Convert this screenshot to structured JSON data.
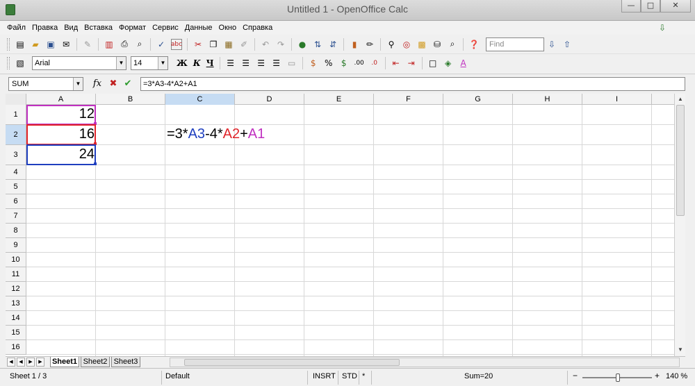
{
  "window": {
    "title": "Untitled 1 - OpenOffice Calc",
    "minimize": "—",
    "maximize": "□",
    "close": "✕"
  },
  "menu": [
    "Файл",
    "Правка",
    "Вид",
    "Вставка",
    "Формат",
    "Сервис",
    "Данные",
    "Окно",
    "Справка"
  ],
  "toolbar": {
    "find_placeholder": "Find",
    "font_name": "Arial",
    "font_size": "14",
    "bold": "Ж",
    "italic": "К",
    "underline": "Ч"
  },
  "formula_bar": {
    "name_box": "SUM",
    "formula": "=3*A3-4*A2+A1"
  },
  "grid": {
    "columns": [
      "A",
      "B",
      "C",
      "D",
      "E",
      "F",
      "G",
      "H",
      "I"
    ],
    "rows": [
      "1",
      "2",
      "3",
      "4",
      "5",
      "6",
      "7",
      "8",
      "9",
      "10",
      "11",
      "12",
      "13",
      "14",
      "15",
      "16"
    ],
    "cells": {
      "A1": "12",
      "A2": "16",
      "A3": "24"
    },
    "editing_cell": {
      "ref": "C2",
      "parts": [
        {
          "text": "=3*",
          "color": "#000000"
        },
        {
          "text": "A3",
          "color": "#1f3fbf"
        },
        {
          "text": "-4*",
          "color": "#000000"
        },
        {
          "text": "A2",
          "color": "#e0242a"
        },
        {
          "text": "+",
          "color": "#000000"
        },
        {
          "text": "A1",
          "color": "#c030c0"
        }
      ]
    },
    "ref_colors": {
      "A1": "#c030c0",
      "A2": "#e0242a",
      "A3": "#1f3fbf"
    }
  },
  "sheets": [
    "Sheet1",
    "Sheet2",
    "Sheet3"
  ],
  "status": {
    "sheet": "Sheet 1 / 3",
    "style": "Default",
    "mode": "INSRT",
    "selection": "STD",
    "modified": "*",
    "sum": "Sum=20",
    "zoom": "140 %"
  }
}
